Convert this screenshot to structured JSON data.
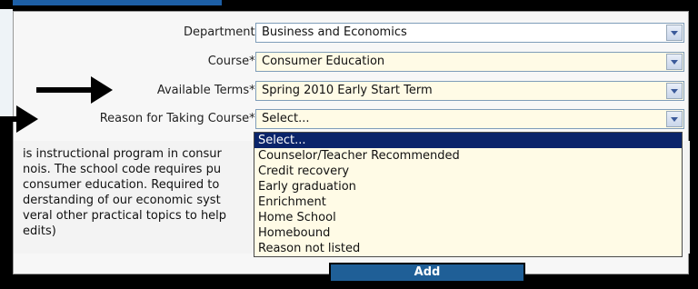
{
  "form": {
    "department": {
      "label": "Department:",
      "value": "Business and Economics"
    },
    "course": {
      "label": "Course*:",
      "value": "Consumer Education"
    },
    "terms": {
      "label": "Available Terms*:",
      "value": "Spring 2010 Early Start Term"
    },
    "reason": {
      "label": "Reason for Taking Course*:",
      "value": "Select..."
    }
  },
  "description": {
    "lines": [
      "is instructional program in consur",
      "nois. The school code requires pu",
      "consumer education. Required to",
      "derstanding of our economic syst",
      "veral other practical topics to help",
      "edits)"
    ]
  },
  "dropdown": {
    "options": [
      "Select...",
      "Counselor/Teacher Recommended",
      "Credit recovery",
      "Early graduation",
      "Enrichment",
      "Home School",
      "Homebound",
      "Reason not listed"
    ]
  },
  "add_label": "Add",
  "colors": {
    "accent": "#1f5f97",
    "selected": "#0a246a",
    "field_yellow": "#fffbe6"
  },
  "icons": {
    "dropdown": "chevron-down-icon",
    "annotation": "arrow-right-icon"
  }
}
